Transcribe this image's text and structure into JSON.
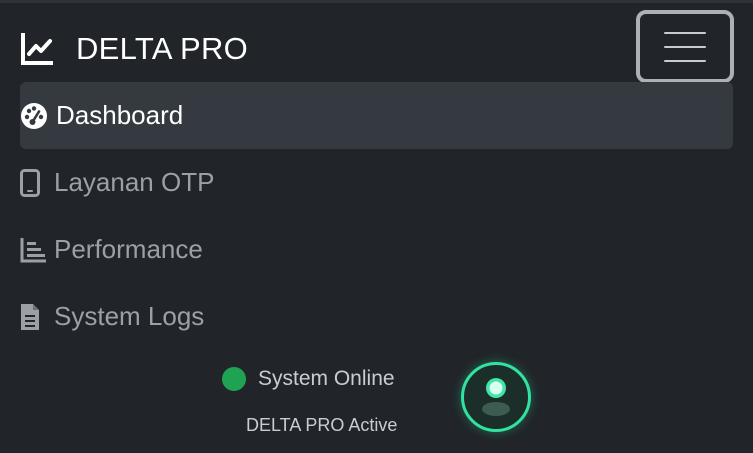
{
  "brand": {
    "name": "DELTA PRO",
    "icon": "line-chart-icon"
  },
  "toggler": {
    "icon": "hamburger-menu-icon"
  },
  "nav": {
    "items": [
      {
        "label": "Dashboard",
        "icon": "tachometer-icon",
        "active": true
      },
      {
        "label": "Layanan OTP",
        "icon": "mobile-phone-icon",
        "active": false
      },
      {
        "label": "Performance",
        "icon": "bar-chart-icon",
        "active": false
      },
      {
        "label": "System Logs",
        "icon": "file-text-icon",
        "active": false
      }
    ]
  },
  "status": {
    "label": "System Online",
    "sublabel": "DELTA PRO Active",
    "dot_color": "#1fa352"
  },
  "avatar": {
    "icon": "user-icon",
    "ring_color": "#2fe3a0"
  },
  "colors": {
    "background": "#212529",
    "active_item_bg": "#343a40",
    "text_primary": "#ffffff",
    "text_muted": "#9aa0a6"
  }
}
